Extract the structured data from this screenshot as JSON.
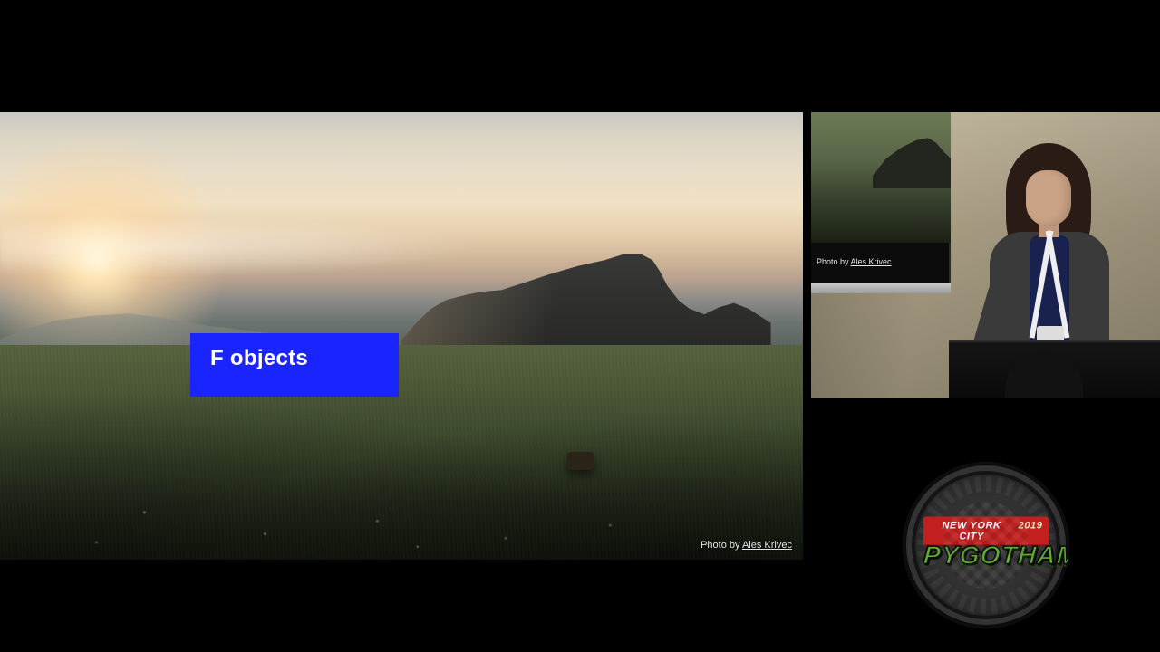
{
  "slide": {
    "title": "F objects",
    "photo_credit_prefix": "Photo by ",
    "photo_credit_name": "Ales Krivec"
  },
  "projector": {
    "photo_credit_prefix": "Photo by ",
    "photo_credit_name": "Ales Krivec"
  },
  "event_logo": {
    "city": "NEW YORK CITY",
    "year": "2019",
    "name": "PYGOTHAM"
  }
}
